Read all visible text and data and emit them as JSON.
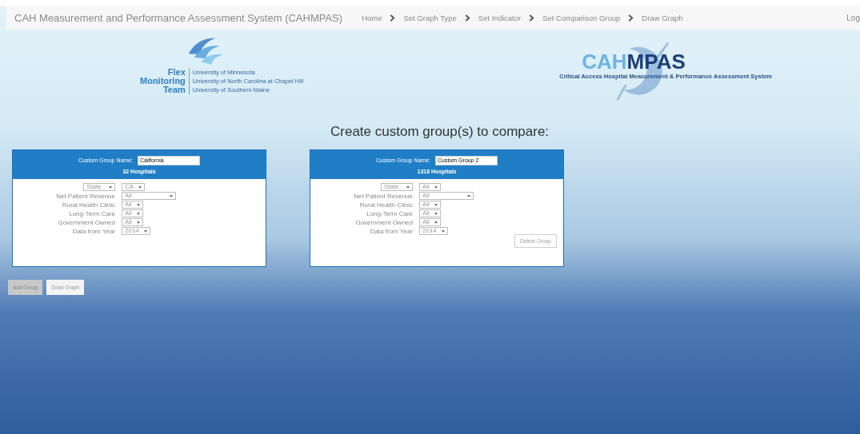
{
  "navbar": {
    "title": "CAH Measurement and Performance Assessment System (CAHMPAS)",
    "breadcrumbs": [
      {
        "label": "Home"
      },
      {
        "label": "Set Graph Type"
      },
      {
        "label": "Set Indicator"
      },
      {
        "label": "Set Comparison Group"
      },
      {
        "label": "Draw Graph"
      }
    ],
    "login": "Log"
  },
  "flex_logo": {
    "words": [
      "Flex",
      "Monitoring",
      "Team"
    ],
    "universities": [
      "University of Minnesota",
      "University of North Carolina at Chapel Hill",
      "University of Southern Maine"
    ]
  },
  "cahmpas_logo": {
    "light": "CAH",
    "dark": "MPAS",
    "subtitle": "Critical Access Hospital Measurement & Performance Assessment System"
  },
  "heading": "Create custom group(s) to compare:",
  "groups": [
    {
      "name_label": "Custom Group Name:",
      "name": "California",
      "count": "32 Hospitals",
      "filters": [
        {
          "kind": "select-label",
          "label": "State",
          "value": "CA",
          "wide": false
        },
        {
          "kind": "label",
          "label": "Net Patient Revenue",
          "value": "All",
          "wide": true
        },
        {
          "kind": "label",
          "label": "Rural Health Clinic",
          "value": "All",
          "wide": false
        },
        {
          "kind": "label",
          "label": "Long-Term Care",
          "value": "All",
          "wide": false
        },
        {
          "kind": "label",
          "label": "Government Owned",
          "value": "All",
          "wide": false
        },
        {
          "kind": "label",
          "label": "Data from Year",
          "value": "2014",
          "wide": false
        }
      ]
    },
    {
      "name_label": "Custom Group Name:",
      "name": "Custom Group 2",
      "count": "1318 Hospitals",
      "delete": "Delete Group",
      "filters": [
        {
          "kind": "select-label",
          "label": "State",
          "value": "All",
          "wide": false
        },
        {
          "kind": "label",
          "label": "Net Patient Revenue",
          "value": "All",
          "wide": true
        },
        {
          "kind": "label",
          "label": "Rural Health Clinic",
          "value": "All",
          "wide": false
        },
        {
          "kind": "label",
          "label": "Long-Term Care",
          "value": "All",
          "wide": false
        },
        {
          "kind": "label",
          "label": "Government Owned",
          "value": "All",
          "wide": false
        },
        {
          "kind": "label",
          "label": "Data from Year",
          "value": "2014",
          "wide": false
        }
      ]
    }
  ],
  "actions": [
    {
      "label": "Add Group",
      "kind": "grey"
    },
    {
      "label": "Draw Graph",
      "kind": "light"
    }
  ]
}
